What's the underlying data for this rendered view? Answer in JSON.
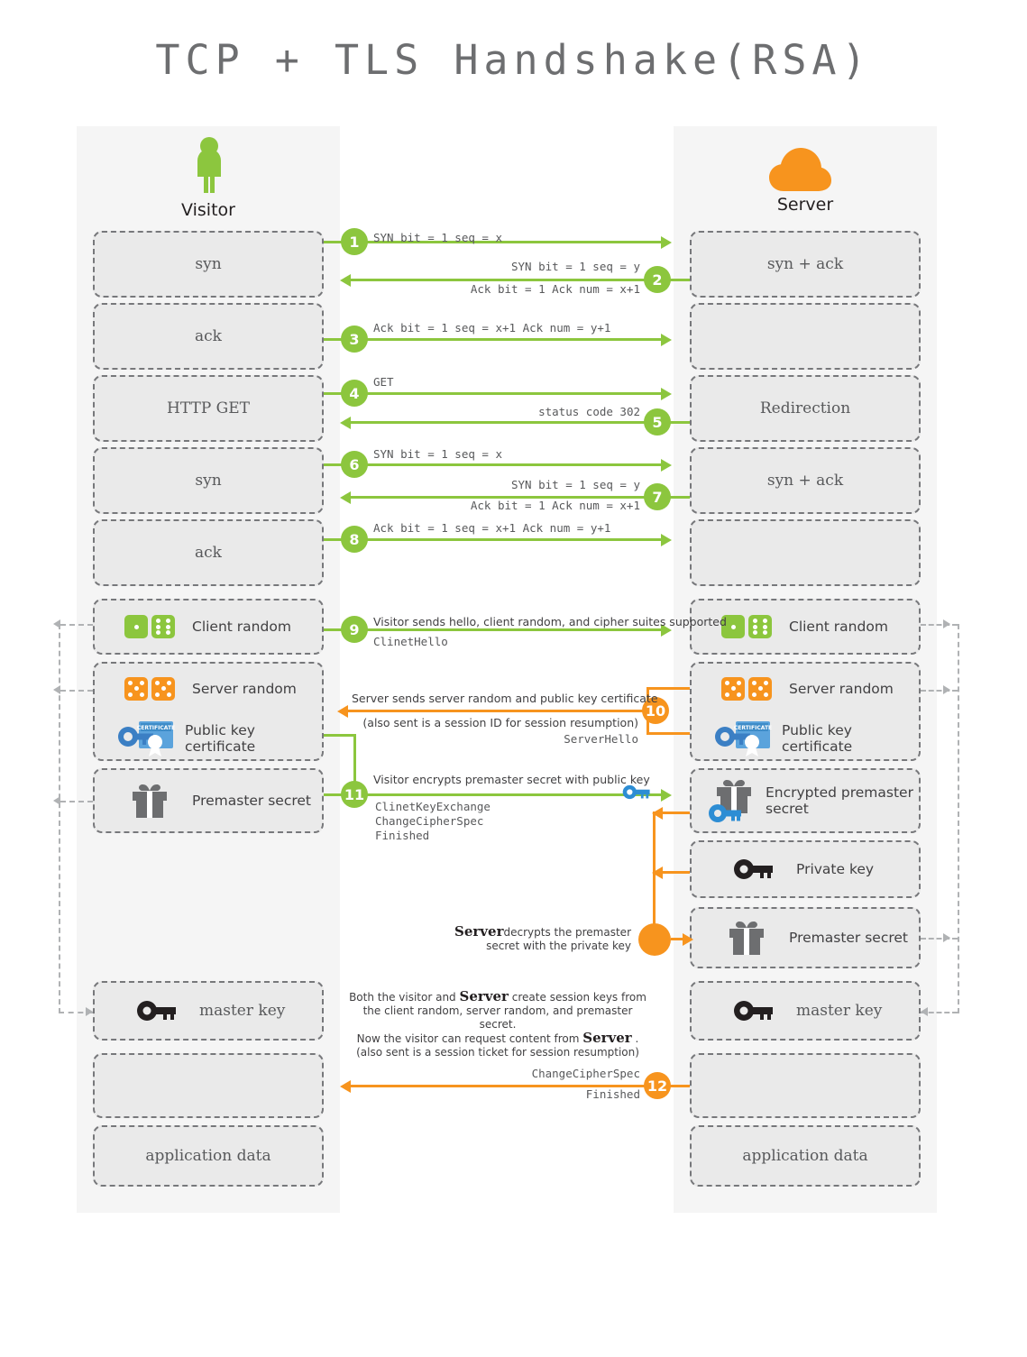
{
  "title": "TCP + TLS Handshake(RSA)",
  "actors": {
    "visitor": {
      "label": "Visitor",
      "icon": "person-icon"
    },
    "server": {
      "label": "Server",
      "icon": "cloud-icon"
    }
  },
  "left_boxes": [
    {
      "id": "syn1",
      "label": "syn"
    },
    {
      "id": "ack1",
      "label": "ack"
    },
    {
      "id": "httpget",
      "label": "HTTP GET"
    },
    {
      "id": "syn2",
      "label": "syn"
    },
    {
      "id": "ack2",
      "label": "ack"
    },
    {
      "id": "client-random",
      "label": "Client random",
      "icon": "green-dice-icon"
    },
    {
      "id": "server-random",
      "label": "Server random",
      "icon": "orange-dice-icon"
    },
    {
      "id": "public-key-cert",
      "label": "Public key certificate",
      "icon": "certificate-key-icon"
    },
    {
      "id": "premaster",
      "label": "Premaster secret",
      "icon": "gift-icon"
    },
    {
      "id": "master-key",
      "label": "master key",
      "icon": "key-icon"
    },
    {
      "id": "blank-left",
      "label": ""
    },
    {
      "id": "app-data-left",
      "label": "application data"
    }
  ],
  "right_boxes": [
    {
      "id": "synack1",
      "label": "syn + ack"
    },
    {
      "id": "blank-r1",
      "label": ""
    },
    {
      "id": "redirection",
      "label": "Redirection"
    },
    {
      "id": "synack2",
      "label": "syn + ack"
    },
    {
      "id": "blank-r2",
      "label": ""
    },
    {
      "id": "client-random-r",
      "label": "Client random",
      "icon": "green-dice-icon"
    },
    {
      "id": "server-random-r",
      "label": "Server random",
      "icon": "orange-dice-icon"
    },
    {
      "id": "public-key-cert-r",
      "label": "Public key certificate",
      "icon": "certificate-key-icon"
    },
    {
      "id": "enc-premaster",
      "label": "Encrypted premaster secret",
      "icon": "gift-key-icon"
    },
    {
      "id": "private-key",
      "label": "Private key",
      "icon": "key-icon"
    },
    {
      "id": "premaster-r",
      "label": "Premaster secret",
      "icon": "gift-icon"
    },
    {
      "id": "master-key-r",
      "label": "master key",
      "icon": "key-icon"
    },
    {
      "id": "blank-r3",
      "label": ""
    },
    {
      "id": "app-data-right",
      "label": "application data"
    }
  ],
  "steps": [
    {
      "n": "1",
      "color": "#8cc63e",
      "dir": "right"
    },
    {
      "n": "2",
      "color": "#8cc63e",
      "dir": "left"
    },
    {
      "n": "3",
      "color": "#8cc63e",
      "dir": "right"
    },
    {
      "n": "4",
      "color": "#8cc63e",
      "dir": "right"
    },
    {
      "n": "5",
      "color": "#8cc63e",
      "dir": "left"
    },
    {
      "n": "6",
      "color": "#8cc63e",
      "dir": "right"
    },
    {
      "n": "7",
      "color": "#8cc63e",
      "dir": "left"
    },
    {
      "n": "8",
      "color": "#8cc63e",
      "dir": "right"
    },
    {
      "n": "9",
      "color": "#8cc63e",
      "dir": "right"
    },
    {
      "n": "10",
      "color": "#f7941e",
      "dir": "left"
    },
    {
      "n": "11",
      "color": "#8cc63e",
      "dir": "right"
    },
    {
      "n": "12",
      "color": "#f7941e",
      "dir": "left"
    }
  ],
  "messages": {
    "m1": "SYN bit = 1 seq = x",
    "m2a": "SYN bit = 1 seq = y",
    "m2b": "Ack bit = 1 Ack num = x+1",
    "m3": "Ack bit = 1 seq = x+1 Ack num = y+1",
    "m4": "GET",
    "m5": "status code 302",
    "m6": "SYN bit = 1 seq = x",
    "m7a": "SYN bit = 1 seq = y",
    "m7b": "Ack bit = 1 Ack num = x+1",
    "m8": "Ack bit = 1 seq = x+1 Ack num = y+1",
    "m9_desc": "Visitor sends hello, client random, and cipher suites supported",
    "m9_proto": "ClinetHello",
    "m10_desc": "Server sends server random and public key certificate",
    "m10_note": "(also sent is a session ID for session resumption)",
    "m10_proto": "ServerHello",
    "m11_desc": "Visitor encrypts premaster secret with public key",
    "m11_proto1": "ClinetKeyExchange",
    "m11_proto2": "ChangeCipherSpec",
    "m11_proto3": "Finished",
    "decrypt_pre": "Server",
    "decrypt_l1": "decrypts the premaster",
    "decrypt_l2": "secret with the private key",
    "master_l1a": "Both the visitor and",
    "master_l1b": "Server",
    "master_l1c": "create session keys from",
    "master_l2": "the client random, server random, and premaster secret.",
    "master_l3a": "Now the visitor can request content from",
    "master_l3b": "Server",
    "master_l3c": ".",
    "master_l4": "(also sent is a session ticket for session resumption)",
    "m12a": "ChangeCipherSpec",
    "m12b": "Finished"
  },
  "colors": {
    "green": "#8cc63e",
    "orange": "#f7941e",
    "blue": "#2d8dd4",
    "gray_box": "#eaeaea",
    "gray_border": "#77787b",
    "lane": "#f5f5f5",
    "text": "#58595b"
  }
}
